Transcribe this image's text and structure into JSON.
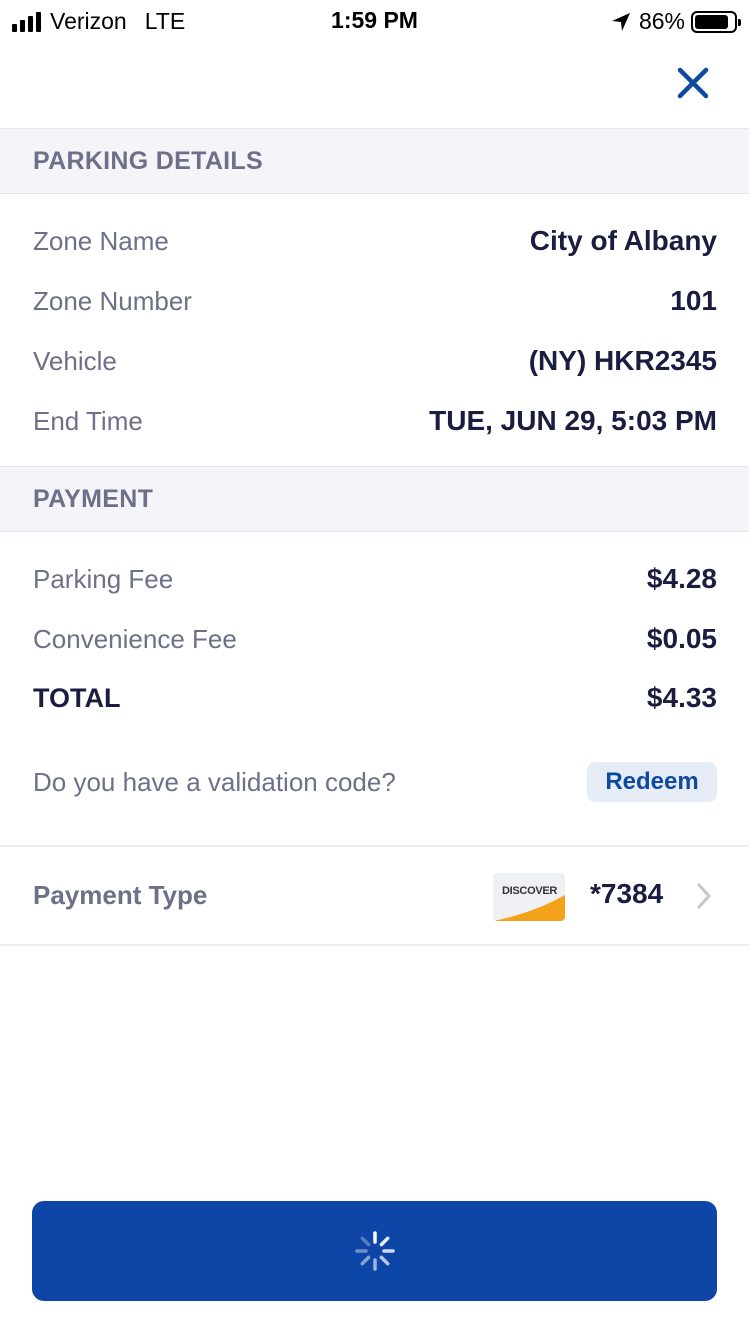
{
  "status_bar": {
    "carrier": "Verizon",
    "network": "LTE",
    "time": "1:59 PM",
    "battery": "86%",
    "battery_level": 0.86
  },
  "close_icon": "close-icon",
  "parking_details": {
    "header": "PARKING DETAILS",
    "rows": [
      {
        "label": "Zone Name",
        "value": "City of Albany"
      },
      {
        "label": "Zone Number",
        "value": "101"
      },
      {
        "label": "Vehicle",
        "value": "(NY) HKR2345"
      },
      {
        "label": "End Time",
        "value": "TUE, JUN 29, 5:03 PM"
      }
    ]
  },
  "payment": {
    "header": "PAYMENT",
    "rows": [
      {
        "label": "Parking Fee",
        "value": "$4.28"
      },
      {
        "label": "Convenience Fee",
        "value": "$0.05"
      },
      {
        "label": "TOTAL",
        "value": "$4.33"
      }
    ],
    "validation_prompt": "Do you have a validation code?",
    "redeem_label": "Redeem"
  },
  "payment_type": {
    "label": "Payment Type",
    "card_brand": "DISCOVER",
    "card_number": "*7384",
    "card_accent_color": "#f5a21b"
  },
  "submit_button": {
    "state": "loading",
    "icon": "spinner-icon",
    "color": "#0d46a6"
  },
  "colors": {
    "accent": "#0f4aa1",
    "label": "#6e7089",
    "value": "#1b1d40",
    "section_bg": "#f4f5f9"
  }
}
